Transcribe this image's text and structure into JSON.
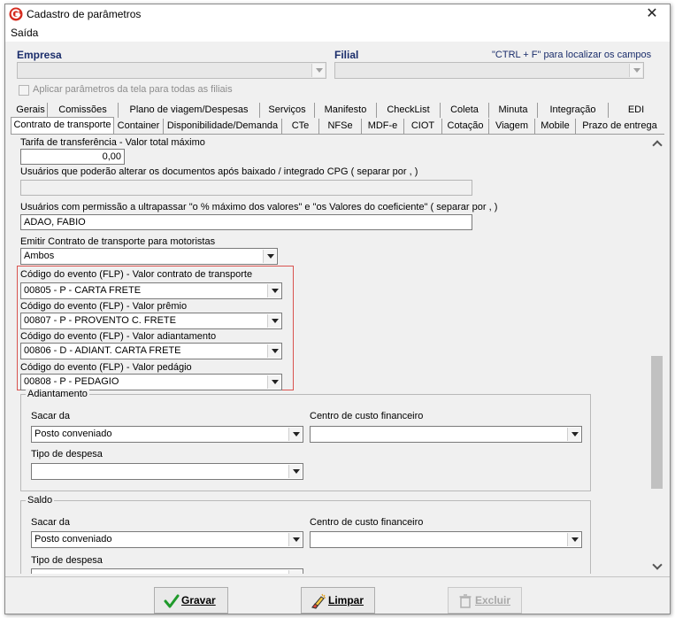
{
  "window": {
    "title": "Cadastro de parâmetros"
  },
  "menu": {
    "file": "Saída"
  },
  "header": {
    "empresa_label": "Empresa",
    "filial_label": "Filial",
    "hint": "\"CTRL + F\" para localizar os campos",
    "apply_all_label": "Aplicar parâmetros da tela para todas as filiais"
  },
  "tabs_row1": [
    "Gerais",
    "Comissões",
    "Plano de viagem/Despesas",
    "Serviços",
    "Manifesto",
    "CheckList",
    "Coleta",
    "Minuta",
    "Integração",
    "EDI"
  ],
  "tabs_row2": [
    "Contrato de transporte",
    "Container",
    "Disponibilidade/Demanda",
    "CTe",
    "NFSe",
    "MDF-e",
    "CIOT",
    "Cotação",
    "Viagem",
    "Mobile",
    "Prazo de entrega"
  ],
  "form": {
    "tarifa_label": "Tarifa de transferência - Valor total máximo",
    "tarifa_value": "0,00",
    "usuarios_baixado_label": "Usuários que poderão alterar os documentos após baixado / integrado CPG ( separar por , )",
    "usuarios_baixado_value": "",
    "usuarios_permissao_label": "Usuários com permissão a ultrapassar \"o % máximo dos valores\" e \"os Valores do coeficiente\"  ( separar por , )",
    "usuarios_permissao_value": "ADAO, FABIO",
    "emitir_label": "Emitir Contrato de transporte para motoristas",
    "emitir_value": "Ambos",
    "evento_contrato_label": "Código do evento (FLP) - Valor contrato de transporte",
    "evento_contrato_value": "00805 - P - CARTA FRETE",
    "evento_premio_label": "Código do evento (FLP) - Valor prêmio",
    "evento_premio_value": "00807 - P - PROVENTO C. FRETE",
    "evento_adiantamento_label": "Código do evento (FLP) - Valor adiantamento",
    "evento_adiantamento_value": "00806 - D - ADIANT. CARTA FRETE",
    "evento_pedagio_label": "Código do evento (FLP) - Valor pedágio",
    "evento_pedagio_value": "00808 - P - PEDAGIO"
  },
  "adiantamento": {
    "title": "Adiantamento",
    "sacar_label": "Sacar da",
    "sacar_value": "Posto conveniado",
    "centro_label": "Centro de custo financeiro",
    "centro_value": "",
    "tipo_label": "Tipo de despesa",
    "tipo_value": ""
  },
  "saldo": {
    "title": "Saldo",
    "sacar_label": "Sacar da",
    "sacar_value": "Posto conveniado",
    "centro_label": "Centro de custo financeiro",
    "centro_value": "",
    "tipo_label": "Tipo de despesa"
  },
  "footer": {
    "gravar": "Gravar",
    "limpar": "Limpar",
    "excluir": "Excluir"
  },
  "colors": {
    "accent_label": "#1a2d6b",
    "highlight": "#d9534f",
    "logo": "#d52b1e"
  }
}
